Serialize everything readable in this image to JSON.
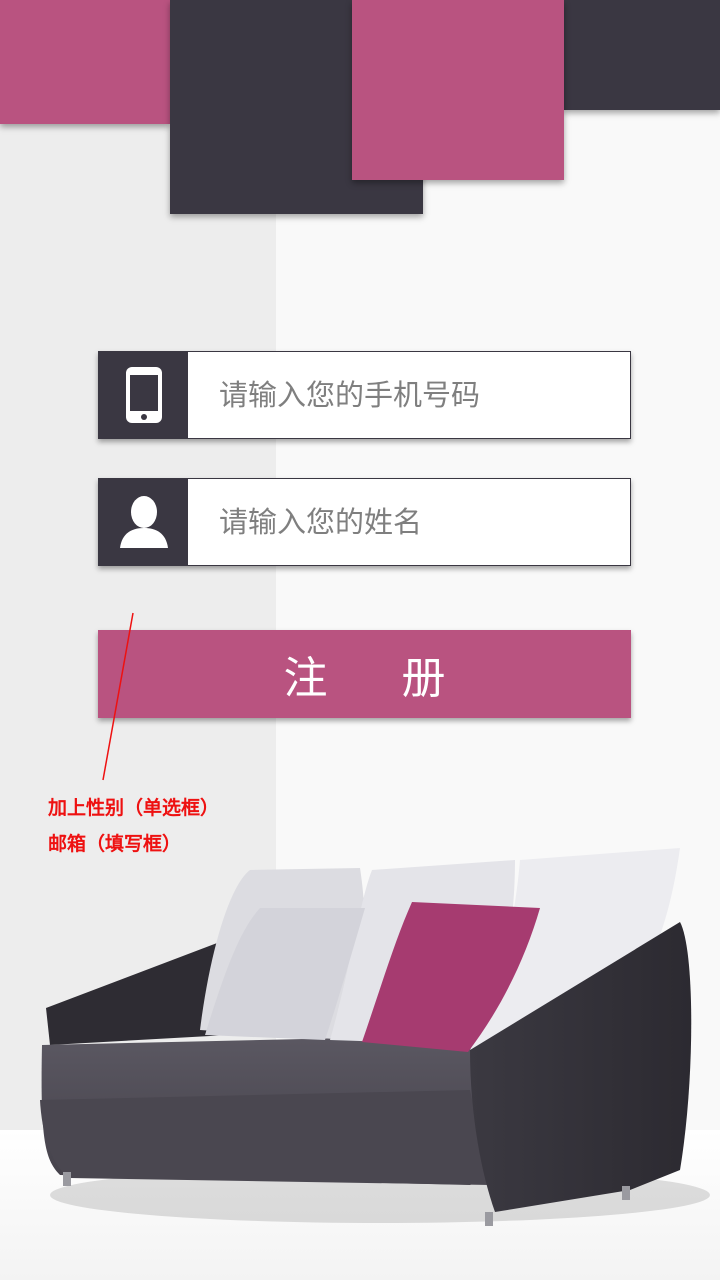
{
  "colors": {
    "accent": "#b95380",
    "dark": "#3a3742",
    "annotation": "#ee1111"
  },
  "form": {
    "phone_placeholder": "请输入您的手机号码",
    "name_placeholder": "请输入您的姓名",
    "submit_label": "注 册"
  },
  "annotation": {
    "line1": "加上性别（单选框）",
    "line2": "邮箱（填写框）"
  },
  "icons": {
    "phone": "phone-icon",
    "user": "user-icon"
  }
}
